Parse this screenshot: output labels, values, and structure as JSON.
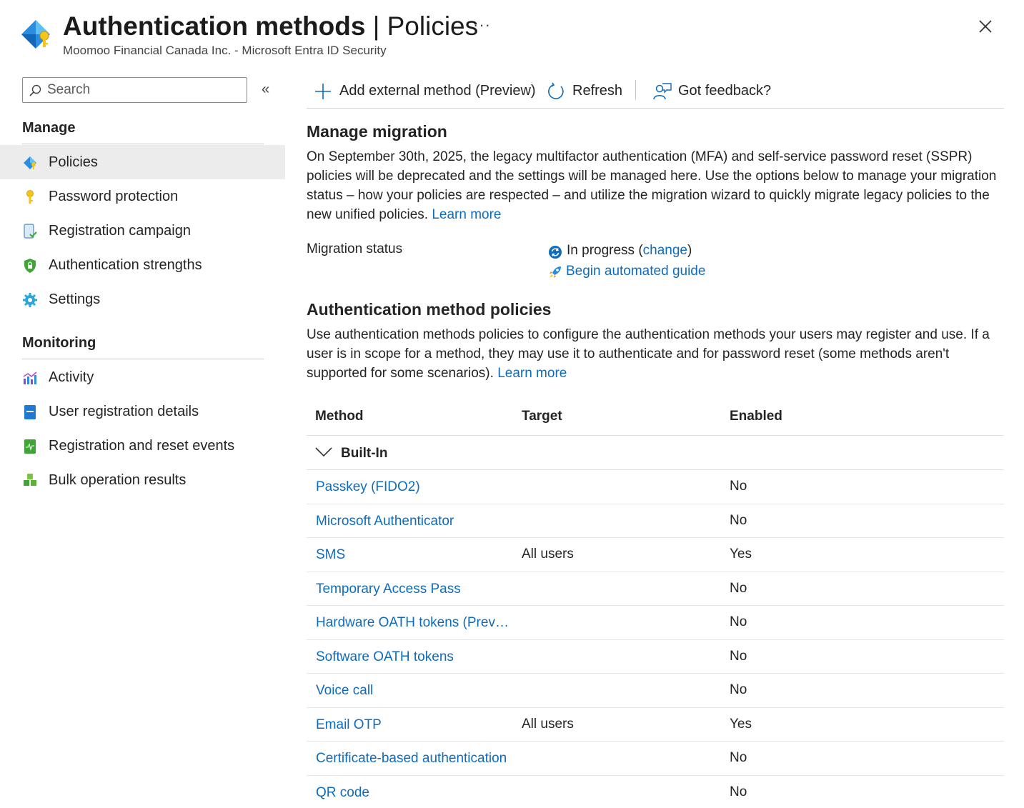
{
  "header": {
    "title_main": "Authentication methods",
    "title_sep": " | ",
    "title_page": "Policies",
    "more_label": "···",
    "subtitle": "Moomoo Financial Canada Inc. - Microsoft Entra ID Security"
  },
  "sidebar": {
    "search_placeholder": "Search",
    "collapse_label": "«",
    "manage_heading": "Manage",
    "manage_items": [
      {
        "label": "Policies",
        "icon": "policies-icon"
      },
      {
        "label": "Password protection",
        "icon": "key-icon"
      },
      {
        "label": "Registration campaign",
        "icon": "device-check-icon"
      },
      {
        "label": "Authentication strengths",
        "icon": "shield-lock-icon"
      },
      {
        "label": "Settings",
        "icon": "gear-icon"
      }
    ],
    "monitoring_heading": "Monitoring",
    "monitoring_items": [
      {
        "label": "Activity",
        "icon": "activity-chart-icon"
      },
      {
        "label": "User registration details",
        "icon": "book-icon"
      },
      {
        "label": "Registration and reset events",
        "icon": "events-icon"
      },
      {
        "label": "Bulk operation results",
        "icon": "cubes-icon"
      }
    ]
  },
  "toolbar": {
    "add_label": "Add external method (Preview)",
    "refresh_label": "Refresh",
    "feedback_label": "Got feedback?"
  },
  "migration": {
    "title": "Manage migration",
    "description": "On September 30th, 2025, the legacy multifactor authentication (MFA) and self-service password reset (SSPR) policies will be deprecated and the settings will be managed here. Use the options below to manage your migration status – how your policies are respected – and utilize the migration wizard to quickly migrate legacy policies to the new unified policies.",
    "learn_more": "Learn more",
    "status_label": "Migration status",
    "status_value": "In progress",
    "change_open": " (",
    "change_link": "change",
    "change_close": ")",
    "guide_link": "Begin automated guide"
  },
  "policies": {
    "title": "Authentication method policies",
    "description": "Use authentication methods policies to configure the authentication methods your users may register and use. If a user is in scope for a method, they may use it to authenticate and for password reset (some methods aren't supported for some scenarios).",
    "learn_more": "Learn more",
    "columns": {
      "method": "Method",
      "target": "Target",
      "enabled": "Enabled"
    },
    "group_label": "Built-In",
    "rows": [
      {
        "method": "Passkey (FIDO2)",
        "target": "",
        "enabled": "No"
      },
      {
        "method": "Microsoft Authenticator",
        "target": "",
        "enabled": "No"
      },
      {
        "method": "SMS",
        "target": "All users",
        "enabled": "Yes"
      },
      {
        "method": "Temporary Access Pass",
        "target": "",
        "enabled": "No"
      },
      {
        "method": "Hardware OATH tokens (Preview)",
        "target": "",
        "enabled": "No"
      },
      {
        "method": "Software OATH tokens",
        "target": "",
        "enabled": "No"
      },
      {
        "method": "Voice call",
        "target": "",
        "enabled": "No"
      },
      {
        "method": "Email OTP",
        "target": "All users",
        "enabled": "Yes"
      },
      {
        "method": "Certificate-based authentication",
        "target": "",
        "enabled": "No"
      },
      {
        "method": "QR code",
        "target": "",
        "enabled": "No"
      }
    ]
  }
}
